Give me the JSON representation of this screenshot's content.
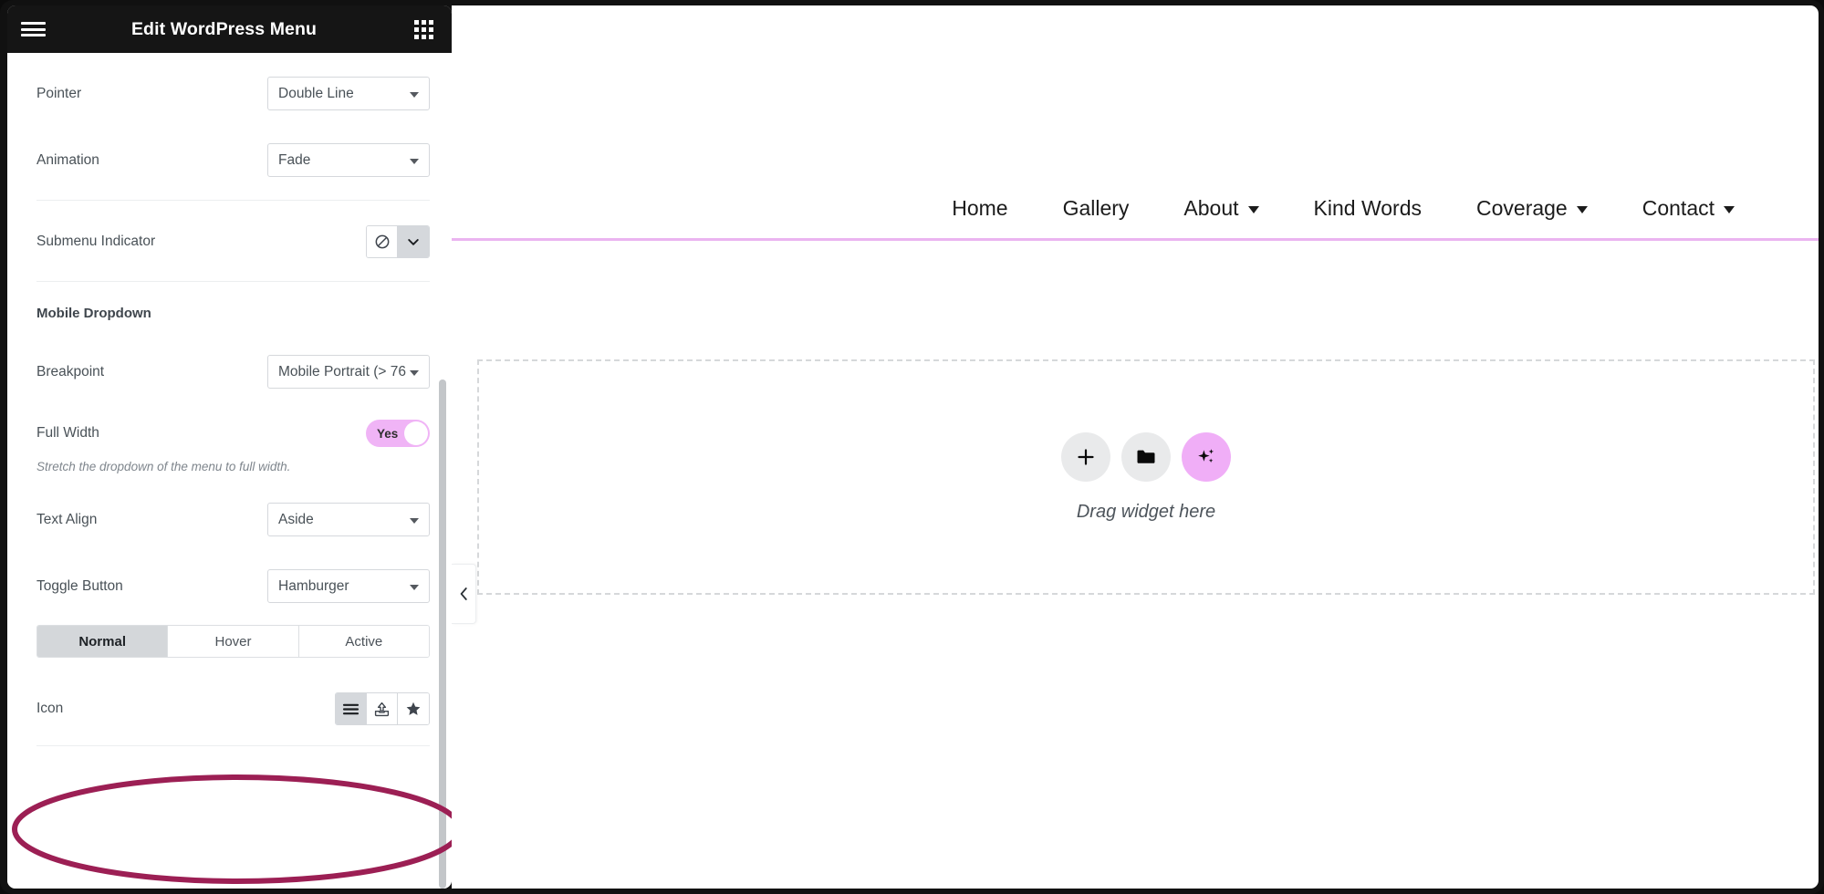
{
  "panel": {
    "title": "Edit WordPress Menu",
    "hamburger_icon": "hamburger-menu-icon",
    "apps_grid_icon": "apps-grid-icon",
    "controls": {
      "pointer": {
        "label": "Pointer",
        "value": "Double Line"
      },
      "animation": {
        "label": "Animation",
        "value": "Fade"
      },
      "submenu_indicator": {
        "label": "Submenu Indicator",
        "options": [
          {
            "icon": "ban-icon",
            "selected": false
          },
          {
            "icon": "chevron-down-icon",
            "selected": true
          }
        ]
      },
      "mobile_dropdown_section": "Mobile Dropdown",
      "breakpoint": {
        "label": "Breakpoint",
        "value": "Mobile Portrait (> 76"
      },
      "full_width": {
        "label": "Full Width",
        "value": "Yes",
        "helper": "Stretch the dropdown of the menu to full width."
      },
      "text_align": {
        "label": "Text Align",
        "value": "Aside"
      },
      "toggle_button": {
        "label": "Toggle Button",
        "value": "Hamburger"
      },
      "state_tabs": [
        {
          "label": "Normal",
          "selected": true
        },
        {
          "label": "Hover",
          "selected": false
        },
        {
          "label": "Active",
          "selected": false
        }
      ],
      "icon": {
        "label": "Icon",
        "options": [
          {
            "icon": "hamburger-lines-icon",
            "selected": true
          },
          {
            "icon": "upload-icon",
            "selected": false
          },
          {
            "icon": "star-icon",
            "selected": false
          }
        ]
      }
    }
  },
  "preview": {
    "nav_items": [
      {
        "label": "Home",
        "has_submenu": false
      },
      {
        "label": "Gallery",
        "has_submenu": false
      },
      {
        "label": "About",
        "has_submenu": true
      },
      {
        "label": "Kind Words",
        "has_submenu": false
      },
      {
        "label": "Coverage",
        "has_submenu": true
      },
      {
        "label": "Contact",
        "has_submenu": true
      }
    ],
    "drop_hint": "Drag widget here",
    "widget_buttons": [
      {
        "icon": "plus-icon",
        "accent": false
      },
      {
        "icon": "folder-icon",
        "accent": false
      },
      {
        "icon": "ai-sparkles-icon",
        "accent": true
      }
    ],
    "collapse_icon": "chevron-left-icon"
  },
  "annotation": {
    "shape": "ellipse",
    "color": "#9c1f54",
    "target": "Icon"
  },
  "colors": {
    "header_bg": "#151515",
    "accent_pink": "#f0b4f6",
    "nav_underline": "#eab4f0",
    "annotation": "#9c1f54",
    "panel_text": "#495157"
  }
}
